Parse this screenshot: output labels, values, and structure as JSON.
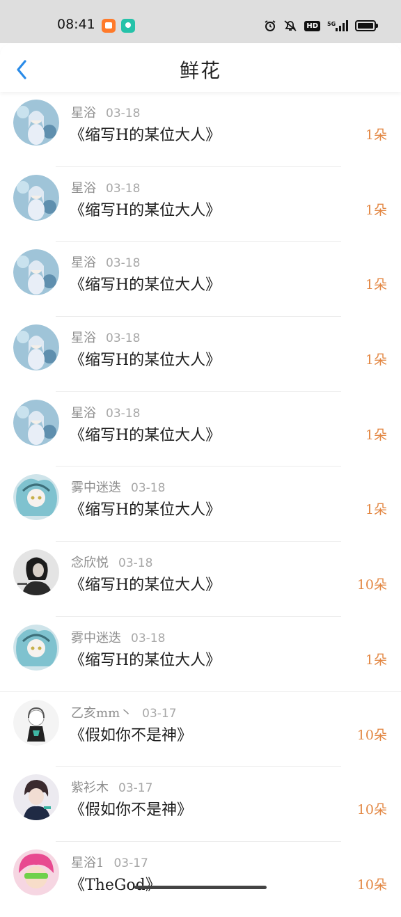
{
  "status_bar": {
    "time": "08:41",
    "hd": "HD",
    "network": "5G"
  },
  "header": {
    "title": "鲜花",
    "back_icon": "chevron-left-icon",
    "accent": "#2a8be8"
  },
  "colors": {
    "count": "#e38743",
    "name": "#8d8d8d"
  },
  "items": [
    {
      "name": "星浴",
      "date": "03-18",
      "book": "《缩写H的某位大人》",
      "count": "1朵",
      "avatar": "anime-girl-blue"
    },
    {
      "name": "星浴",
      "date": "03-18",
      "book": "《缩写H的某位大人》",
      "count": "1朵",
      "avatar": "anime-girl-blue"
    },
    {
      "name": "星浴",
      "date": "03-18",
      "book": "《缩写H的某位大人》",
      "count": "1朵",
      "avatar": "anime-girl-blue"
    },
    {
      "name": "星浴",
      "date": "03-18",
      "book": "《缩写H的某位大人》",
      "count": "1朵",
      "avatar": "anime-girl-blue"
    },
    {
      "name": "星浴",
      "date": "03-18",
      "book": "《缩写H的某位大人》",
      "count": "1朵",
      "avatar": "anime-girl-blue"
    },
    {
      "name": "雾中迷迭",
      "date": "03-18",
      "book": "《缩写H的某位大人》",
      "count": "1朵",
      "avatar": "anime-girl-teal"
    },
    {
      "name": "念欣悦",
      "date": "03-18",
      "book": "《缩写H的某位大人》",
      "count": "10朵",
      "avatar": "bw-portrait"
    },
    {
      "name": "雾中迷迭",
      "date": "03-18",
      "book": "《缩写H的某位大人》",
      "count": "1朵",
      "avatar": "anime-girl-teal"
    },
    {
      "name": "乙亥mm丶",
      "date": "03-17",
      "book": "《假如你不是神》",
      "count": "10朵",
      "avatar": "sketch-girl"
    },
    {
      "name": "紫衫木",
      "date": "03-17",
      "book": "《假如你不是神》",
      "count": "10朵",
      "avatar": "dark-hair-boy"
    },
    {
      "name": "星浴1",
      "date": "03-17",
      "book": "《TheGod》",
      "count": "10朵",
      "avatar": "pink-hair-character"
    }
  ]
}
